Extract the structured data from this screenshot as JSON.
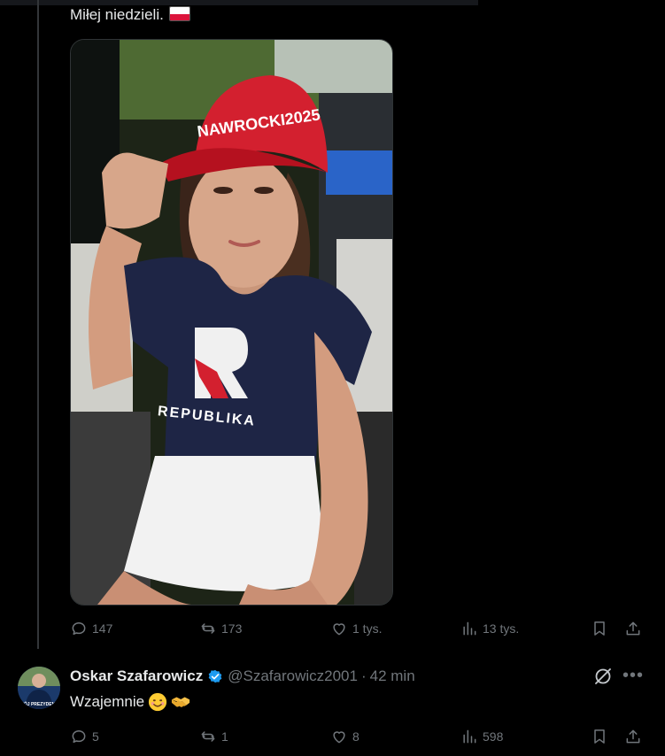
{
  "post": {
    "text": "Miłej niedzieli.",
    "flag": "poland-flag",
    "image": {
      "cap_text": "NAWROCKI2025",
      "shirt_letter": "R",
      "shirt_text": "REPUBLIKA"
    },
    "stats": {
      "replies": "147",
      "reposts": "173",
      "likes": "1 tys.",
      "views": "13 tys."
    }
  },
  "reply": {
    "name": "Oskar Szafarowicz",
    "handle": "@Szafarowicz2001",
    "separator": "·",
    "time": "42 min",
    "text": "Wzajemnie",
    "avatar_text": "MÓJ PREZYDENT",
    "emojis": [
      "smiling-face-emoji",
      "handshake-emoji"
    ],
    "stats": {
      "replies": "5",
      "reposts": "1",
      "likes": "8",
      "views": "598"
    }
  },
  "colors": {
    "background": "#000000",
    "text": "#e7e9ea",
    "muted": "#71767b",
    "verified": "#1d9bf0",
    "divider": "#333639"
  }
}
